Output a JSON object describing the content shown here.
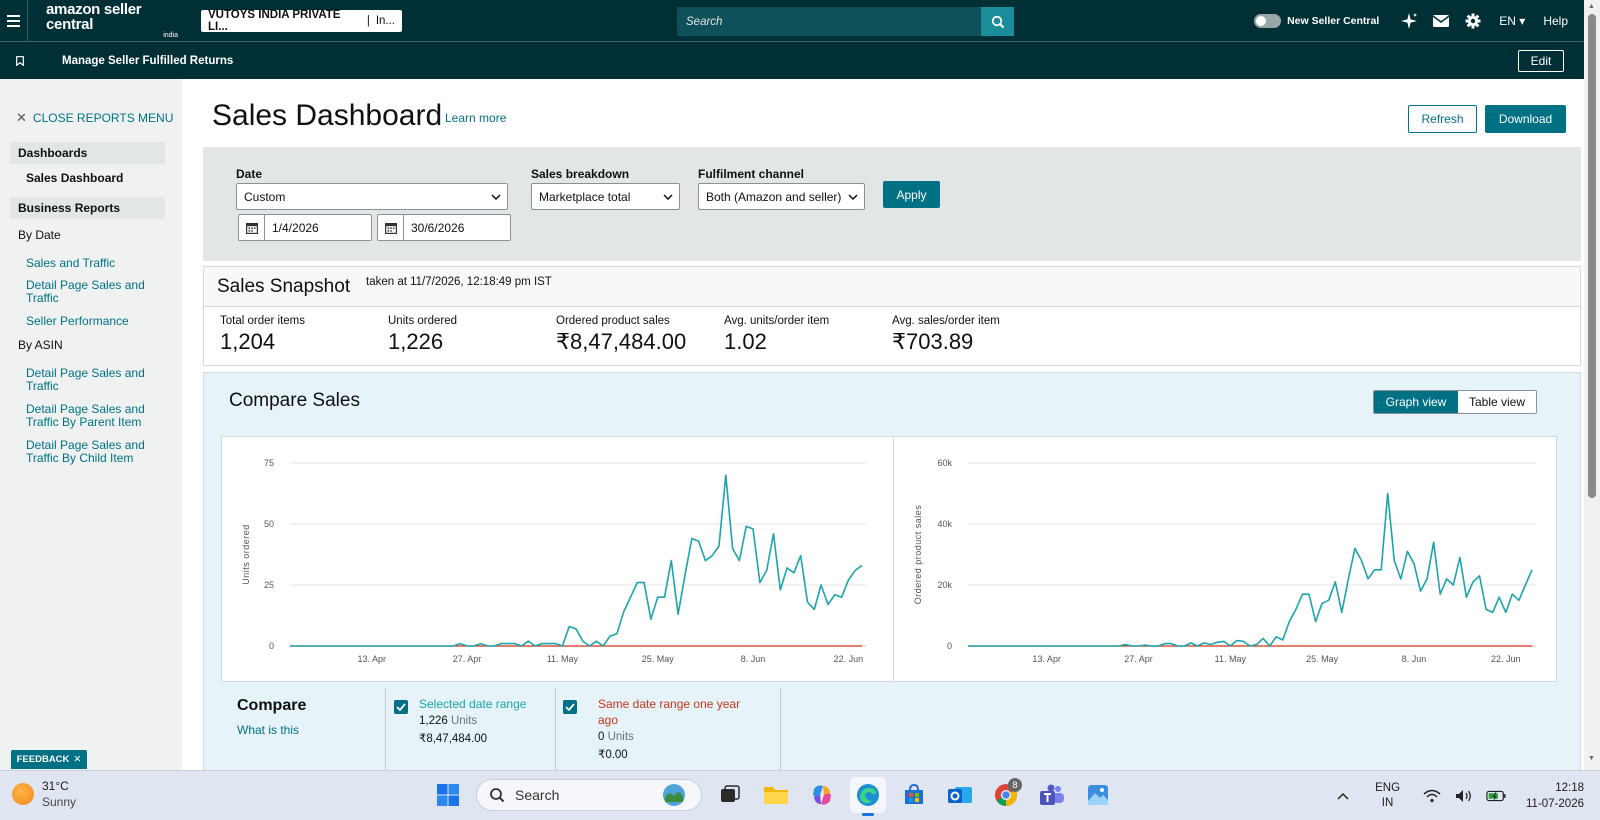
{
  "topnav": {
    "logo_main": "amazon seller central",
    "logo_sub": "india",
    "account_name": "VUTOYS INDIA PRIVATE LI...",
    "marketplace": "In...",
    "search_placeholder": "Search",
    "new_seller_central_label": "New Seller Central",
    "language": "EN",
    "help": "Help"
  },
  "subnav": {
    "bookmark_title": "Manage Seller Fulfilled Returns",
    "edit": "Edit"
  },
  "leftmenu": {
    "close": "CLOSE REPORTS MENU",
    "dashboards_header": "Dashboards",
    "sales_dashboard": "Sales Dashboard",
    "business_reports_header": "Business Reports",
    "by_date": "By Date",
    "by_date_links": [
      "Sales and Traffic",
      "Detail Page Sales and Traffic",
      "Seller Performance"
    ],
    "by_asin": "By ASIN",
    "by_asin_links": [
      "Detail Page Sales and Traffic",
      "Detail Page Sales and Traffic By Parent Item",
      "Detail Page Sales and Traffic By Child Item"
    ],
    "feedback": "FEEDBACK"
  },
  "page": {
    "title": "Sales Dashboard",
    "learn_more": "Learn more",
    "refresh": "Refresh",
    "download": "Download"
  },
  "filters": {
    "date_label": "Date",
    "date_value": "Custom",
    "start_date": "1/4/2026",
    "end_date": "30/6/2026",
    "breakdown_label": "Sales breakdown",
    "breakdown_value": "Marketplace total",
    "channel_label": "Fulfilment channel",
    "channel_value": "Both (Amazon and seller)",
    "apply": "Apply"
  },
  "snapshot": {
    "title": "Sales Snapshot",
    "taken": "taken at 11/7/2026, 12:18:49 pm IST",
    "metrics": [
      {
        "label": "Total order items",
        "value": "1,204"
      },
      {
        "label": "Units ordered",
        "value": "1,226"
      },
      {
        "label": "Ordered product sales",
        "value": "₹8,47,484.00"
      },
      {
        "label": "Avg. units/order item",
        "value": "1.02"
      },
      {
        "label": "Avg. sales/order item",
        "value": "₹703.89"
      }
    ]
  },
  "compare": {
    "title": "Compare Sales",
    "graph_view": "Graph view",
    "table_view": "Table view",
    "compare_label": "Compare",
    "what_is_this": "What is this",
    "selected_label": "Selected date range",
    "selected_units_value": "1,226",
    "selected_units_word": "Units",
    "selected_sales": "₹8,47,484.00",
    "lastyear_label": "Same date range one year ago",
    "lastyear_units_value": "0",
    "lastyear_units_word": "Units",
    "lastyear_sales": "₹0.00",
    "colors": {
      "selected": "#1ca4ad",
      "last_year": "#d13212"
    }
  },
  "chart_data": [
    {
      "type": "line",
      "ylabel": "Units ordered",
      "ylim": [
        0,
        75
      ],
      "yticks": [
        "0",
        "25",
        "50",
        "75"
      ],
      "xticks": [
        "13. Apr",
        "27. Apr",
        "11. May",
        "25. May",
        "8. Jun",
        "22. Jun"
      ],
      "grid": true,
      "x_start": "1 Apr",
      "series": [
        {
          "name": "Selected date range",
          "values": [
            0,
            0,
            0,
            0,
            0,
            0,
            0,
            0,
            0,
            0,
            0,
            0,
            0,
            0,
            0,
            0,
            0,
            0,
            0,
            0,
            0,
            0,
            0,
            0,
            0,
            1,
            0,
            0,
            1,
            0,
            0,
            1,
            1,
            1,
            0,
            2,
            0,
            1,
            1,
            1,
            0,
            8,
            7,
            2,
            0,
            2,
            0,
            4,
            5,
            14,
            20,
            26,
            26,
            11,
            20,
            20,
            35,
            13,
            29,
            44,
            43,
            35,
            37,
            41,
            70,
            40,
            35,
            49,
            48,
            26,
            31,
            46,
            23,
            32,
            30,
            37,
            18,
            15,
            25,
            17,
            21,
            20,
            27,
            31,
            33
          ]
        },
        {
          "name": "Same date range one year ago",
          "values": [
            0,
            0,
            0,
            0,
            0,
            0,
            0,
            0,
            0,
            0,
            0,
            0,
            0,
            0,
            0,
            0,
            0,
            0,
            0,
            0,
            0,
            0,
            0,
            0,
            0,
            0,
            0,
            0,
            0,
            0,
            0,
            0,
            0,
            0,
            0,
            0,
            0,
            0,
            0,
            0,
            0,
            0,
            0,
            0,
            0,
            0,
            0,
            0,
            0,
            0,
            0,
            0,
            0,
            0,
            0,
            0,
            0,
            0,
            0,
            0,
            0,
            0,
            0,
            0,
            0,
            0,
            0,
            0,
            0,
            0,
            0,
            0,
            0,
            0,
            0,
            0,
            0,
            0,
            0,
            0,
            0,
            0,
            0,
            0,
            0
          ]
        }
      ]
    },
    {
      "type": "line",
      "ylabel": "Ordered product sales",
      "ylim": [
        0,
        60000
      ],
      "yticks": [
        "0",
        "20k",
        "40k",
        "60k"
      ],
      "xticks": [
        "13. Apr",
        "27. Apr",
        "11. May",
        "25. May",
        "8. Jun",
        "22. Jun"
      ],
      "grid": true,
      "x_start": "1 Apr",
      "series": [
        {
          "name": "Selected date range",
          "values": [
            0,
            0,
            0,
            0,
            0,
            0,
            0,
            0,
            0,
            0,
            0,
            0,
            0,
            0,
            0,
            0,
            0,
            0,
            0,
            0,
            0,
            0,
            0,
            0,
            500,
            0,
            0,
            300,
            0,
            0,
            800,
            800,
            0,
            0,
            1000,
            0,
            1000,
            500,
            1200,
            1500,
            0,
            1800,
            1500,
            0,
            500,
            2500,
            0,
            3000,
            2000,
            8000,
            12000,
            17000,
            17000,
            8000,
            14000,
            15000,
            21000,
            11000,
            22000,
            32000,
            28000,
            22000,
            25000,
            25000,
            50000,
            28000,
            22000,
            31000,
            27000,
            18000,
            22000,
            34000,
            17000,
            22000,
            20000,
            29000,
            16000,
            21000,
            23000,
            12000,
            11000,
            16000,
            11000,
            17000,
            15000,
            20000,
            25000
          ]
        },
        {
          "name": "Same date range one year ago",
          "values": [
            0,
            0,
            0,
            0,
            0,
            0,
            0,
            0,
            0,
            0,
            0,
            0,
            0,
            0,
            0,
            0,
            0,
            0,
            0,
            0,
            0,
            0,
            0,
            0,
            0,
            0,
            0,
            0,
            0,
            0,
            0,
            0,
            0,
            0,
            0,
            0,
            0,
            0,
            0,
            0,
            0,
            0,
            0,
            0,
            0,
            0,
            0,
            0,
            0,
            0,
            0,
            0,
            0,
            0,
            0,
            0,
            0,
            0,
            0,
            0,
            0,
            0,
            0,
            0,
            0,
            0,
            0,
            0,
            0,
            0,
            0,
            0,
            0,
            0,
            0,
            0,
            0,
            0,
            0,
            0,
            0,
            0,
            0,
            0,
            0,
            0,
            0,
            0,
            0
          ]
        }
      ]
    }
  ],
  "taskbar": {
    "temp": "31°C",
    "weather": "Sunny",
    "search": "Search",
    "chrome_badge": "8",
    "lang_line1": "ENG",
    "lang_line2": "IN",
    "time": "12:18",
    "date": "11-07-2026"
  }
}
